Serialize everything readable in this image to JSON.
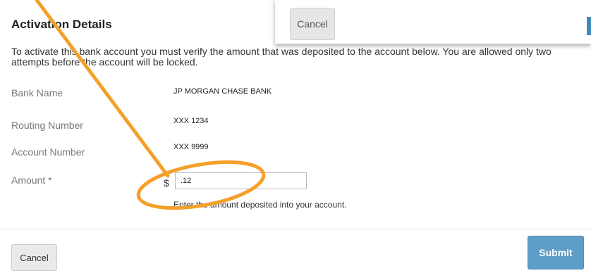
{
  "background_dialog": {
    "cancel_label": "Cancel"
  },
  "panel": {
    "title": "Activation Details",
    "intro": "To activate this bank account you must verify the amount that was deposited to the account below. You are allowed only two attempts before the account will be locked."
  },
  "fields": {
    "bank_name": {
      "label": "Bank Name",
      "value": "JP MORGAN CHASE BANK"
    },
    "routing_number": {
      "label": "Routing Number",
      "value": "XXX 1234"
    },
    "account_number": {
      "label": "Account Number",
      "value": "XXX 9999"
    },
    "amount": {
      "label": "Amount *",
      "currency_symbol": "$",
      "value": ".12",
      "help": "Enter the amount deposited into your account."
    }
  },
  "footer": {
    "cancel_label": "Cancel",
    "submit_label": "Submit"
  },
  "colors": {
    "primary_button": "#5e9dc7",
    "annotation": "#f5a02a"
  }
}
